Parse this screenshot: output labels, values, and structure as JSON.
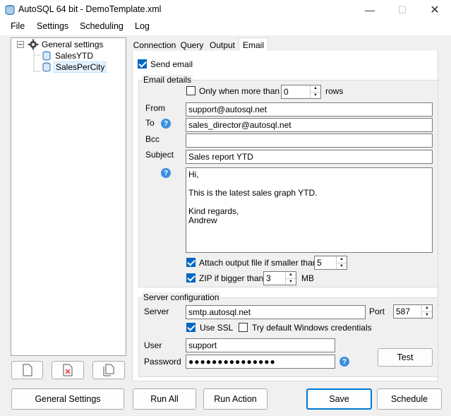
{
  "window": {
    "title": "AutoSQL 64 bit - DemoTemplate.xml"
  },
  "menu": [
    {
      "label": "File"
    },
    {
      "label": "Settings"
    },
    {
      "label": "Scheduling"
    },
    {
      "label": "Log"
    }
  ],
  "tree": {
    "root": "General settings",
    "children": [
      "SalesYTD",
      "SalesPerCity"
    ],
    "selected": "SalesPerCity"
  },
  "tabs": [
    {
      "label": "Connection"
    },
    {
      "label": "Query"
    },
    {
      "label": "Output"
    },
    {
      "label": "Email"
    }
  ],
  "active_tab": "Email",
  "email": {
    "send_email_label": "Send email",
    "send_email_checked": true,
    "details_title": "Email details",
    "only_when_label": "Only when more than",
    "only_when_checked": false,
    "only_when_value": "0",
    "rows_label": "rows",
    "from_label": "From",
    "from_value": "support@autosql.net",
    "to_label": "To",
    "to_value": "sales_director@autosql.net",
    "bcc_label": "Bcc",
    "bcc_value": "",
    "subject_label": "Subject",
    "subject_value": "Sales report YTD",
    "body": "Hi,\n\nThis is the latest sales graph YTD.\n\nKind regards,\nAndrew",
    "attach_label": "Attach output file if smaller than",
    "attach_checked": true,
    "attach_value": "5",
    "zip_label": "ZIP if bigger than",
    "zip_checked": true,
    "zip_value": "3",
    "zip_unit": "MB"
  },
  "server": {
    "title": "Server configuration",
    "server_label": "Server",
    "server_value": "smtp.autosql.net",
    "port_label": "Port",
    "port_value": "587",
    "use_ssl_label": "Use SSL",
    "use_ssl_checked": true,
    "windows_creds_label": "Try default Windows credentials",
    "windows_creds_checked": false,
    "user_label": "User",
    "user_value": "support",
    "password_label": "Password",
    "password_value": "●●●●●●●●●●●●●●●",
    "test_label": "Test"
  },
  "footer": {
    "general_settings": "General Settings",
    "run_all": "Run All",
    "run_action": "Run Action",
    "save": "Save",
    "schedule": "Schedule"
  },
  "colors": {
    "accent": "#0067c0",
    "help": "#3d8fe0"
  }
}
